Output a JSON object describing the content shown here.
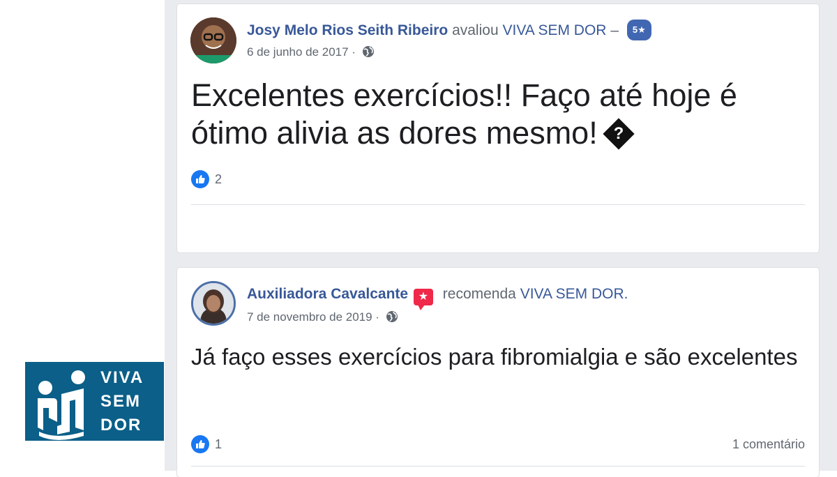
{
  "posts": [
    {
      "author": "Josy Melo Rios Seith Ribeiro",
      "action": "avaliou",
      "page": "VIVA SEM DOR",
      "separator": "–",
      "rating_badge": "5★",
      "date": "6 de junho de 2017 ·",
      "text": "Excelentes exercícios!! Faço até hoje é ótimo alivia as dores mesmo!",
      "emoji_glyph": "?",
      "likes": "2"
    },
    {
      "author": "Auxiliadora Cavalcante",
      "action": "recomenda",
      "page": "VIVA SEM DOR.",
      "date": "7 de novembro de 2019 ·",
      "text": "Já faço esses exercícios para fibromialgia e são excelentes",
      "likes": "1",
      "comments": "1 comentário"
    }
  ],
  "logo": {
    "line1": "VIVA",
    "line2": "SEM",
    "line3": "DOR",
    "background": "#0b5f88"
  },
  "colors": {
    "link": "#385898",
    "like": "#1877f2",
    "recommend": "#f02849",
    "feed_background": "#e9ebee"
  },
  "icons": {
    "privacy": "globe-icon",
    "reaction": "like-icon",
    "recommendation": "recommend-icon"
  }
}
